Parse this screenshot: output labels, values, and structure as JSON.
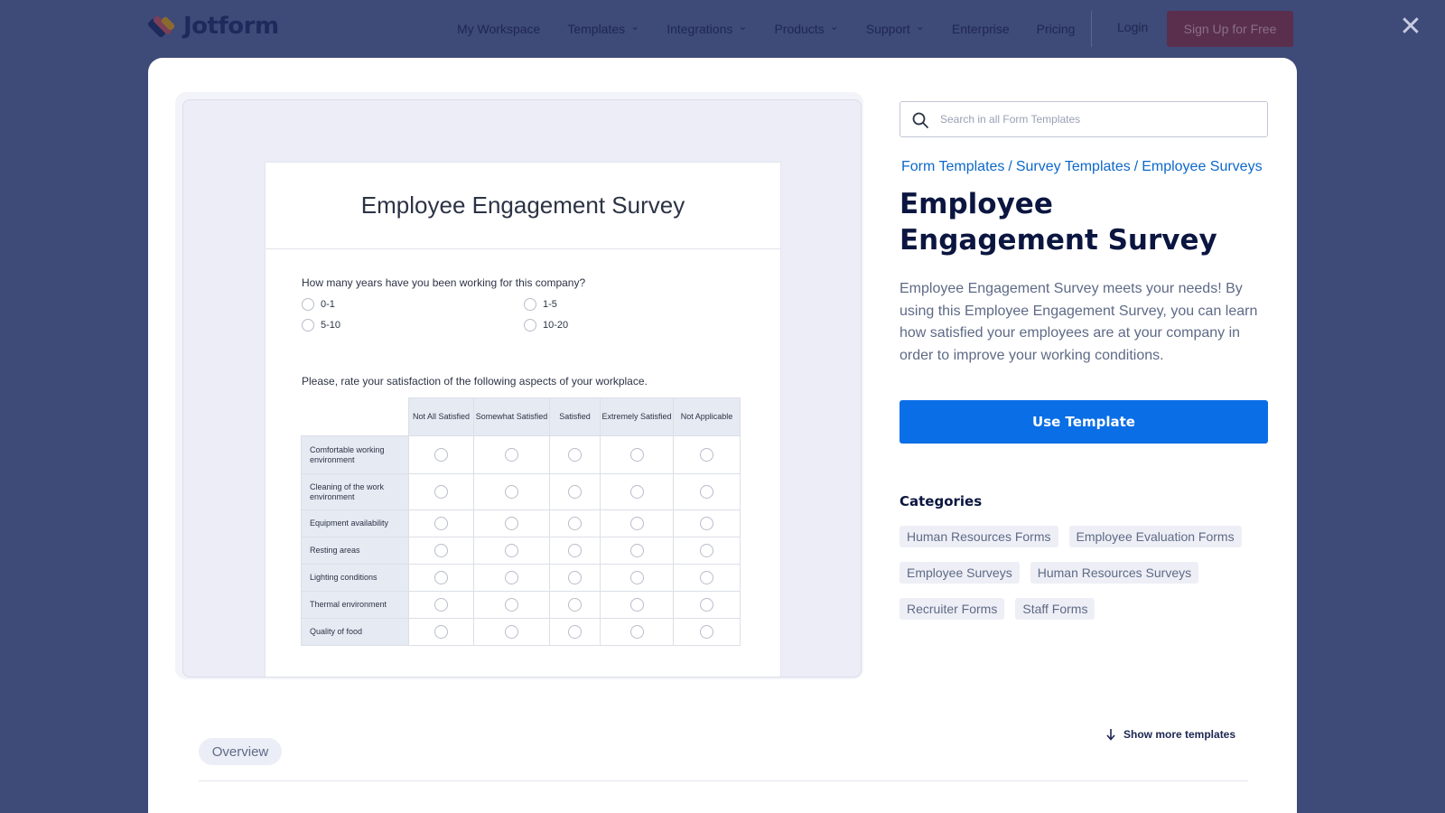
{
  "brand": {
    "name": "Jotform"
  },
  "nav": {
    "items": [
      {
        "label": "My Workspace",
        "has_menu": false
      },
      {
        "label": "Templates",
        "has_menu": true
      },
      {
        "label": "Integrations",
        "has_menu": true
      },
      {
        "label": "Products",
        "has_menu": true
      },
      {
        "label": "Support",
        "has_menu": true
      },
      {
        "label": "Enterprise",
        "has_menu": false
      },
      {
        "label": "Pricing",
        "has_menu": false
      }
    ],
    "login": "Login",
    "signup": "Sign Up for Free",
    "close_glyph": "✕"
  },
  "preview": {
    "form_title": "Employee Engagement Survey",
    "q1": {
      "text": "How many years have you been working for this company?",
      "options": [
        "0-1",
        "1-5",
        "5-10",
        "10-20"
      ]
    },
    "q2": {
      "text": "Please, rate your satisfaction of the following aspects of your workplace.",
      "columns": [
        "Not All Satisfied",
        "Somewhat Satisfied",
        "Satisfied",
        "Extremely Satisfied",
        "Not Applicable"
      ],
      "rows": [
        "Comfortable working environment",
        "Cleaning of the work environment",
        "Equipment availability",
        "Resting areas",
        "Lighting conditions",
        "Thermal environment",
        "Quality of food"
      ]
    }
  },
  "search": {
    "placeholder": "Search in all Form Templates"
  },
  "breadcrumb": [
    "Form Templates",
    "Survey Templates",
    "Employee Surveys"
  ],
  "breadcrumb_sep": "/",
  "template": {
    "title": "Employee Engagement Survey",
    "description": "Employee Engagement Survey meets your needs! By using this Employee Engagement Survey, you can learn how satisfied your employees are at your company in order to improve your working conditions.",
    "use_button": "Use Template"
  },
  "categories": {
    "title": "Categories",
    "rows": [
      [
        "Human Resources Forms",
        "Employee Evaluation Forms"
      ],
      [
        "Employee Surveys",
        "Human Resources Surveys"
      ],
      [
        "Recruiter Forms",
        "Staff Forms"
      ]
    ]
  },
  "footer": {
    "overview": "Overview",
    "show_more": "Show more templates"
  },
  "colors": {
    "backdrop": "#3e4a78",
    "accent": "#0a6ee6",
    "signup_bg": "#5a2f4e"
  }
}
